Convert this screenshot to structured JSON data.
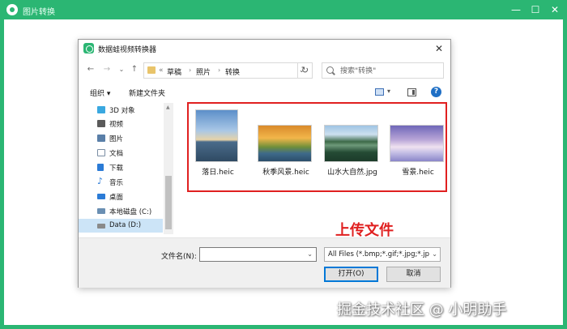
{
  "app": {
    "title": "图片转换",
    "minimize_glyph": "—",
    "maximize_glyph": "☐",
    "close_glyph": "✕"
  },
  "dialog": {
    "title": "数据蛙视频转换器",
    "close_glyph": "✕",
    "nav": {
      "back_glyph": "←",
      "forward_glyph": "→",
      "recent_glyph": "⌄",
      "up_glyph": "↑",
      "refresh_glyph": "↻"
    },
    "address": {
      "overflow": "«",
      "crumbs": [
        "草稿",
        "照片",
        "转换"
      ],
      "separator": "›",
      "dropdown_glyph": "⌄"
    },
    "search": {
      "placeholder": "搜索\"转换\""
    },
    "commands": {
      "organize": "组织 ▾",
      "new_folder": "新建文件夹",
      "view_dropdown_glyph": "▾",
      "help_glyph": "?"
    },
    "nav_pane": [
      {
        "label": "3D 对象",
        "icon": "cube-icon",
        "color": "#3aa8e0"
      },
      {
        "label": "视频",
        "icon": "video-icon",
        "color": "#5a5a5a"
      },
      {
        "label": "图片",
        "icon": "picture-icon",
        "color": "#5a7fa8"
      },
      {
        "label": "文档",
        "icon": "document-icon",
        "color": "#7a8da3"
      },
      {
        "label": "下载",
        "icon": "download-icon",
        "color": "#2b7bd6"
      },
      {
        "label": "音乐",
        "icon": "music-icon",
        "color": "#2b7bd6"
      },
      {
        "label": "桌面",
        "icon": "desktop-icon",
        "color": "#2b7bd6"
      },
      {
        "label": "本地磁盘 (C:)",
        "icon": "drive-icon",
        "color": "#6a8fb3"
      },
      {
        "label": "Data (D:)",
        "icon": "drive-icon",
        "color": "#8a8a8a",
        "selected": true
      }
    ],
    "files": [
      {
        "name": "落日.heic",
        "icon": "sunset-image"
      },
      {
        "name": "秋季风景.heic",
        "icon": "autumn-image"
      },
      {
        "name": "山水大自然.jpg",
        "icon": "lake-image"
      },
      {
        "name": "雪景.heic",
        "icon": "snow-image"
      }
    ],
    "bottom": {
      "filename_label": "文件名(N):",
      "filename_value": "",
      "filetype_value": "All Files (*.bmp;*.gif;*.jpg;*.jp",
      "dropdown_glyph": "⌄",
      "open_label": "打开(O)",
      "cancel_label": "取消"
    }
  },
  "annotation": {
    "label": "上传文件",
    "color": "#e02020"
  },
  "watermark": "掘金技术社区 @ 小明助手",
  "colors": {
    "accent": "#2bb673",
    "selection": "#cce4f7",
    "annotation": "#e02020"
  }
}
